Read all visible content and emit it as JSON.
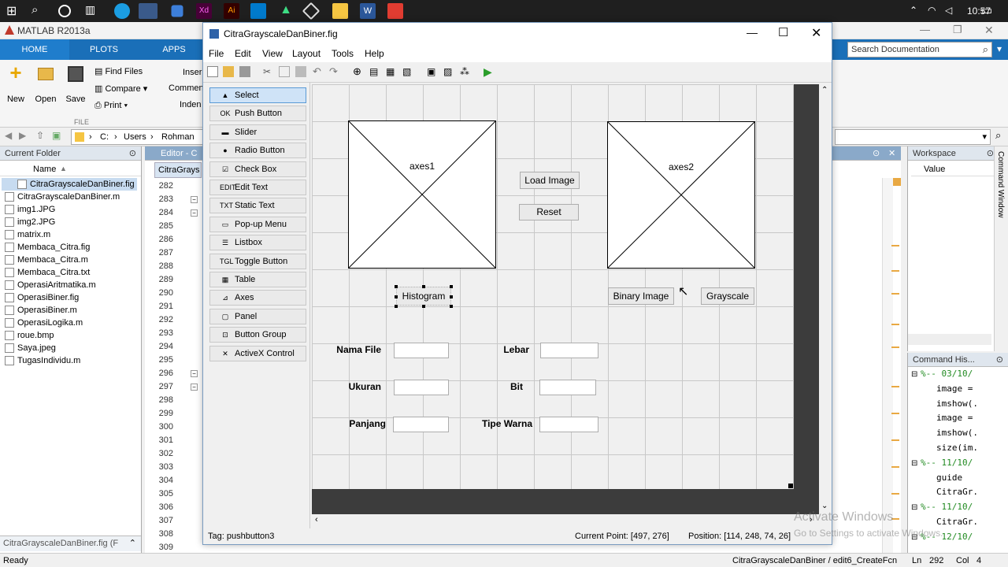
{
  "taskbar": {
    "time": "10:57"
  },
  "matlab": {
    "title": "MATLAB R2013a",
    "tabs": [
      "HOME",
      "PLOTS",
      "APPS"
    ],
    "ribbon": {
      "new": "New",
      "open": "Open",
      "save": "Save",
      "find_files": "Find Files",
      "compare": "Compare",
      "print": "Print",
      "insert": "Inser",
      "comment": "Commen",
      "indent": "Inden",
      "group_file": "FILE"
    },
    "search_placeholder": "Search Documentation",
    "address": {
      "drive": "C:",
      "p1": "Users",
      "p2": "Rohman"
    },
    "current_folder": {
      "header": "Current Folder",
      "column": "Name",
      "files": [
        "CitraGrayscaleDanBiner.fig",
        "CitraGrayscaleDanBiner.m",
        "img1.JPG",
        "img2.JPG",
        "matrix.m",
        "Membaca_Citra.fig",
        "Membaca_Citra.m",
        "Membaca_Citra.txt",
        "OperasiAritmatika.m",
        "OperasiBiner.fig",
        "OperasiBiner.m",
        "OperasiLogika.m",
        "roue.bmp",
        "Saya.jpeg",
        "TugasIndividu.m"
      ],
      "footer": "CitraGrayscaleDanBiner.fig (F"
    },
    "editor": {
      "header": "Editor - C",
      "tab": "CitraGrays",
      "lines": [
        "282",
        "283",
        "284",
        "285",
        "286",
        "287",
        "288",
        "289",
        "290",
        "291",
        "292",
        "293",
        "294",
        "295",
        "296",
        "297",
        "298",
        "299",
        "300",
        "301",
        "302",
        "303",
        "304",
        "305",
        "306",
        "307",
        "308",
        "309"
      ]
    },
    "workspace": {
      "header": "Workspace",
      "column": "Value"
    },
    "command_history": {
      "header": "Command His...",
      "items": [
        "%-- 03/10/",
        "image =",
        "imshow(.",
        "image =",
        "imshow(.",
        "size(im.",
        "%-- 11/10/",
        "guide",
        "CitraGr.",
        "%-- 11/10/",
        "CitraGr.",
        "%-- 12/10/"
      ]
    },
    "side_label": "Command Window",
    "status": {
      "ready": "Ready",
      "file": "CitraGrayscaleDanBiner / edit6_CreateFcn",
      "ln_label": "Ln",
      "ln": "292",
      "col_label": "Col",
      "col": "4"
    },
    "watermark": {
      "line1": "Activate Windows",
      "line2": "Go to Settings to activate Windows."
    }
  },
  "guide": {
    "title": "CitraGrayscaleDanBiner.fig",
    "menu": [
      "File",
      "Edit",
      "View",
      "Layout",
      "Tools",
      "Help"
    ],
    "palette": [
      {
        "label": "Select",
        "icon": "▲"
      },
      {
        "label": "Push Button",
        "icon": "OK"
      },
      {
        "label": "Slider",
        "icon": "▬"
      },
      {
        "label": "Radio Button",
        "icon": "●"
      },
      {
        "label": "Check Box",
        "icon": "☑"
      },
      {
        "label": "Edit Text",
        "icon": "EDIT"
      },
      {
        "label": "Static Text",
        "icon": "TXT"
      },
      {
        "label": "Pop-up Menu",
        "icon": "▭"
      },
      {
        "label": "Listbox",
        "icon": "☰"
      },
      {
        "label": "Toggle Button",
        "icon": "TGL"
      },
      {
        "label": "Table",
        "icon": "▦"
      },
      {
        "label": "Axes",
        "icon": "⊿"
      },
      {
        "label": "Panel",
        "icon": "▢"
      },
      {
        "label": "Button Group",
        "icon": "⊡"
      },
      {
        "label": "ActiveX Control",
        "icon": "✕"
      }
    ],
    "canvas": {
      "axes1": "axes1",
      "axes2": "axes2",
      "load_image": "Load Image",
      "reset": "Reset",
      "histogram": "Histogram",
      "binary_image": "Binary Image",
      "grayscale": "Grayscale",
      "nama_file": "Nama File",
      "ukuran": "Ukuran",
      "panjang": "Panjang",
      "lebar": "Lebar",
      "bit": "Bit",
      "tipe_warna": "Tipe Warna"
    },
    "status": {
      "tag": "Tag: pushbutton3",
      "current_point": "Current Point:  [497, 276]",
      "position": "Position: [114, 248, 74, 26]"
    }
  }
}
